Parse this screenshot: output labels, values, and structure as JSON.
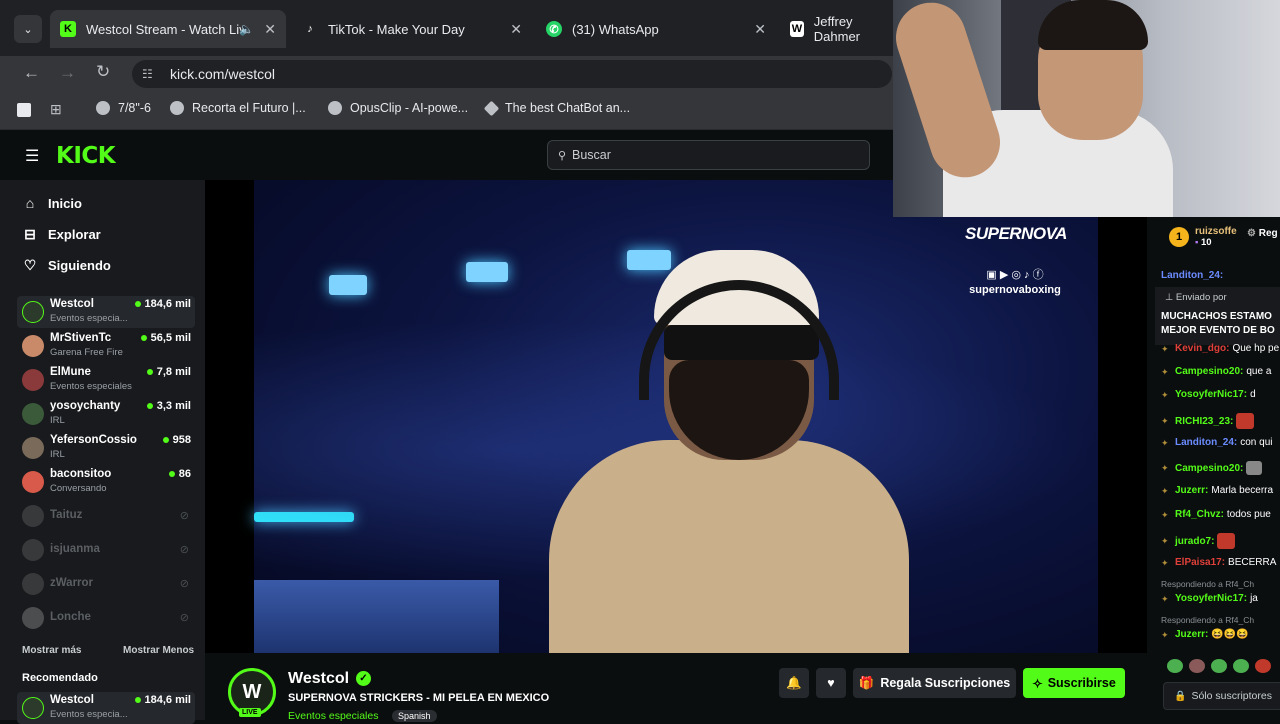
{
  "tabs": [
    {
      "title": "Westcol Stream - Watch Liv"
    },
    {
      "title": "TikTok - Make Your Day"
    },
    {
      "title": "(31) WhatsApp"
    },
    {
      "title": "Jeffrey Dahmer"
    }
  ],
  "address": "kick.com/westcol",
  "bookmarks": [
    "7/8\"-6",
    "Recorta el Futuro |...",
    "OpusClip - AI-powe...",
    "The best ChatBot an..."
  ],
  "brand": {
    "logo": "KICK",
    "accent": "#53fc18"
  },
  "search_placeholder": "Buscar",
  "nav": [
    {
      "label": "Inicio"
    },
    {
      "label": "Explorar"
    },
    {
      "label": "Siguiendo"
    }
  ],
  "channels": [
    {
      "name": "Westcol",
      "category": "Eventos especia...",
      "viewers": "184,6 mil"
    },
    {
      "name": "MrStivenTc",
      "category": "Garena Free Fire",
      "viewers": "56,5 mil"
    },
    {
      "name": "ElMune",
      "category": "Eventos especiales",
      "viewers": "7,8 mil"
    },
    {
      "name": "yosoychanty",
      "category": "IRL",
      "viewers": "3,3 mil"
    },
    {
      "name": "YefersonCossio",
      "category": "IRL",
      "viewers": "958"
    },
    {
      "name": "baconsitoo",
      "category": "Conversando",
      "viewers": "86"
    }
  ],
  "offline": [
    "Taituz",
    "isjuanma",
    "zWarror",
    "Lonche"
  ],
  "show_more": "Mostrar más",
  "show_less": "Mostrar Menos",
  "recommended_title": "Recomendado",
  "recommended": {
    "name": "Westcol",
    "category": "Eventos especia...",
    "viewers": "184,6 mil"
  },
  "overlay": {
    "brand": "SUPERNOVA",
    "handle": "supernovaboxing"
  },
  "stream": {
    "channel": "Westcol",
    "title": "SUPERNOVA STRICKERS - MI PELEA EN MEXICO",
    "category": "Eventos especiales",
    "language": "Spanish",
    "live": "LIVE"
  },
  "buttons": {
    "gift": "Regala Suscripciones",
    "subscribe": "Suscribirse"
  },
  "chat": {
    "top_user": "ruizsoffe",
    "top_count": "10",
    "top_extra": "Reg",
    "pinned_by": "Enviado por",
    "pinned_text_1": "MUCHACHOS ESTAMO",
    "pinned_text_2": "MEJOR EVENTO DE BO",
    "messages": [
      {
        "user": "Landiton_24:",
        "text": "",
        "color": "#6b8cff"
      },
      {
        "user": "Kevin_dgo:",
        "text": "Que hp pe",
        "color": "#e0403a"
      },
      {
        "user": "Campesino20:",
        "text": "que a",
        "color": "#53fc18"
      },
      {
        "user": "YosoyferNic17:",
        "text": "d",
        "color": "#53fc18"
      },
      {
        "user": "RICHI23_23:",
        "text": "",
        "color": "#53fc18"
      },
      {
        "user": "Landiton_24:",
        "text": "con qui",
        "color": "#6b8cff"
      },
      {
        "user": "Campesino20:",
        "text": "",
        "color": "#53fc18"
      },
      {
        "user": "Juzerr:",
        "text": "Marla becerra",
        "color": "#53fc18"
      },
      {
        "user": "Rf4_Chvz:",
        "text": "todos pue",
        "color": "#53fc18"
      },
      {
        "user": "jurado7:",
        "text": "",
        "color": "#53fc18"
      },
      {
        "user": "ElPaisa17:",
        "text": "BECERRA",
        "color": "#e0403a"
      },
      {
        "user": "YosoyferNic17:",
        "text": "ja",
        "color": "#53fc18"
      },
      {
        "user": "Juzerr:",
        "text": "😆😆😆",
        "color": "#53fc18"
      }
    ],
    "reply_label": "Respondiendo a Rf4_Ch",
    "subs_only": "Sólo suscriptores"
  }
}
